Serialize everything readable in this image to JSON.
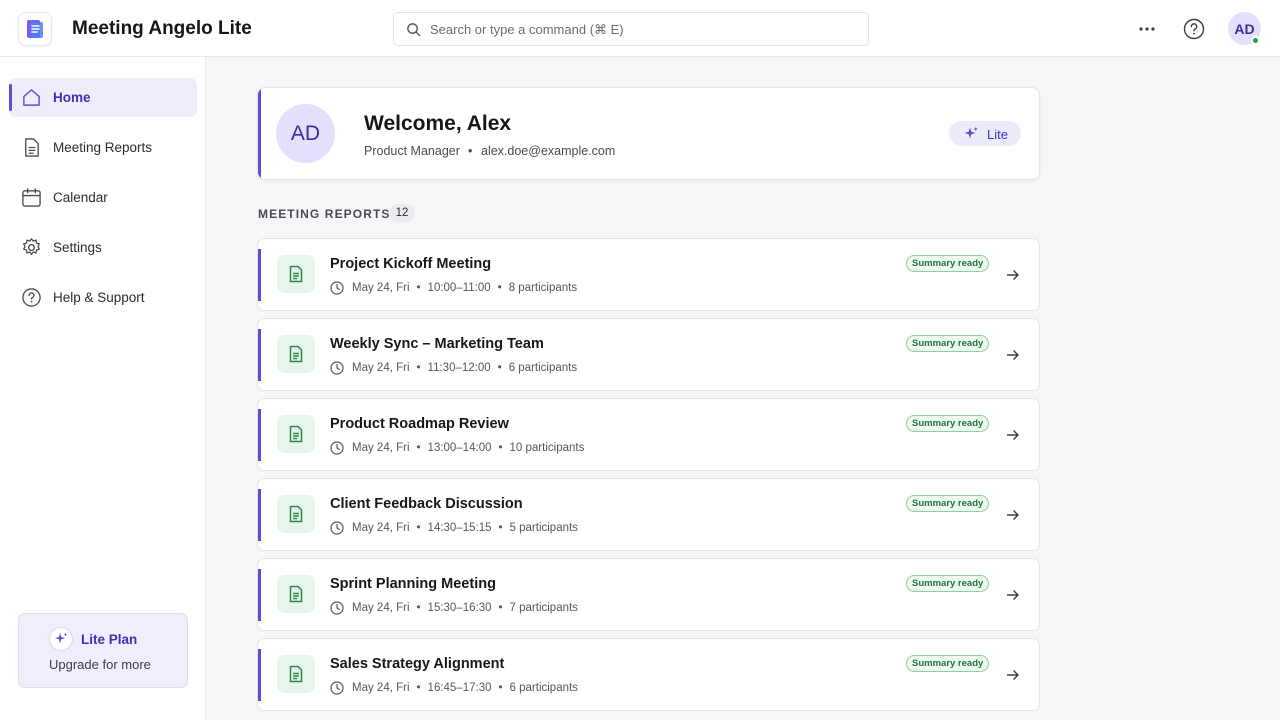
{
  "app": {
    "title": "Meeting Angelo Lite"
  },
  "search": {
    "placeholder": "Search or type a command (⌘ E)"
  },
  "header": {
    "avatar_initials": "AD",
    "more_icon": "more-horizontal-icon",
    "help_icon": "help-circle-icon"
  },
  "sidebar": {
    "items": [
      {
        "label": "Home",
        "icon": "home-icon",
        "active": true
      },
      {
        "label": "Meeting Reports",
        "icon": "document-icon",
        "active": false
      },
      {
        "label": "Calendar",
        "icon": "calendar-icon",
        "active": false
      },
      {
        "label": "Settings",
        "icon": "gear-icon",
        "active": false
      },
      {
        "label": "Help & Support",
        "icon": "help-circle-icon",
        "active": false
      }
    ],
    "plan": {
      "title": "Lite Plan",
      "subtitle": "Upgrade for more",
      "icon": "sparkle-icon"
    }
  },
  "welcome": {
    "initials": "AD",
    "title": "Welcome, Alex",
    "role": "Product Manager",
    "separator": "•",
    "email": "alex.doe@example.com",
    "badge_label": "Lite"
  },
  "reports_section": {
    "title": "MEETING REPORTS",
    "count": "12"
  },
  "reports": [
    {
      "title": "Project Kickoff Meeting",
      "date": "May 24, Fri",
      "time": "10:00–11:00",
      "participants": "8 participants",
      "status": "Summary ready"
    },
    {
      "title": "Weekly Sync – Marketing Team",
      "date": "May 24, Fri",
      "time": "11:30–12:00",
      "participants": "6 participants",
      "status": "Summary ready"
    },
    {
      "title": "Product Roadmap Review",
      "date": "May 24, Fri",
      "time": "13:00–14:00",
      "participants": "10 participants",
      "status": "Summary ready"
    },
    {
      "title": "Client Feedback Discussion",
      "date": "May 24, Fri",
      "time": "14:30–15:15",
      "participants": "5 participants",
      "status": "Summary ready"
    },
    {
      "title": "Sprint Planning Meeting",
      "date": "May 24, Fri",
      "time": "15:30–16:30",
      "participants": "7 participants",
      "status": "Summary ready"
    },
    {
      "title": "Sales Strategy Alignment",
      "date": "May 24, Fri",
      "time": "16:45–17:30",
      "participants": "6 participants",
      "status": "Summary ready"
    }
  ],
  "colors": {
    "accent": "#5b4fd6",
    "status_green": "#1d7a3a",
    "online": "#1fa34a"
  }
}
